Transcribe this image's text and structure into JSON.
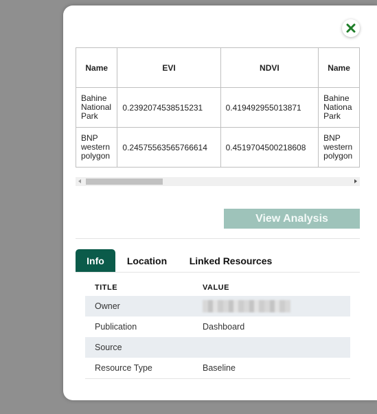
{
  "attribute_table": {
    "columns": [
      "Name",
      "EVI",
      "NDVI",
      "Name"
    ],
    "rows": [
      [
        "Bahine National Park",
        "0.2392074538515231",
        "0.419492955013871",
        "Bahine Nationa Park"
      ],
      [
        "BNP western polygon",
        "0.24575563565766614",
        "0.4519704500218608",
        "BNP western polygon"
      ]
    ]
  },
  "actions": {
    "view_analysis_label": "View Analysis"
  },
  "tabs": [
    {
      "label": "Info",
      "active": true
    },
    {
      "label": "Location",
      "active": false
    },
    {
      "label": "Linked Resources",
      "active": false
    }
  ],
  "info": {
    "header_title": "TITLE",
    "header_value": "VALUE",
    "rows": [
      {
        "title": "Owner",
        "value": ""
      },
      {
        "title": "Publication",
        "value": "Dashboard"
      },
      {
        "title": "Source",
        "value": ""
      },
      {
        "title": "Resource Type",
        "value": "Baseline"
      }
    ]
  },
  "colors": {
    "backdrop": "#8f8f8f",
    "accent": "#0b5b4a",
    "button_disabled": "#9ec3ba",
    "close_icon": "#1e7d28"
  },
  "icons": {
    "close": "close-icon"
  }
}
